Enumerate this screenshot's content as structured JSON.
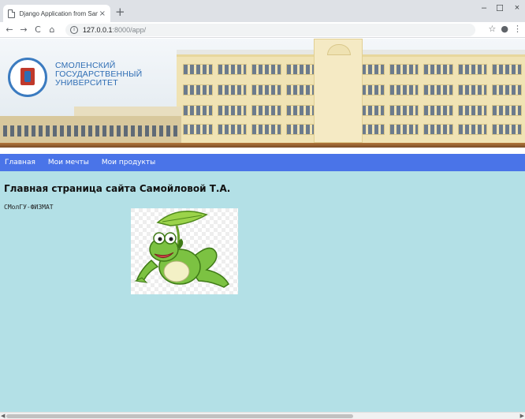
{
  "browser": {
    "tab_title": "Django Application from Samoilo",
    "tab_close": "×",
    "new_tab": "+",
    "minimize": "–",
    "maximize": "☐",
    "close": "×",
    "nav_back": "←",
    "nav_forward": "→",
    "nav_reload": "C",
    "nav_home": "⌂",
    "info": "i",
    "url_host": "127.0.0.1",
    "url_rest": ":8000/app/",
    "star": "☆",
    "account": "●",
    "menu": "⋮"
  },
  "banner": {
    "university_line1": "СМОЛЕНСКИЙ",
    "university_line2": "ГОСУДАРСТВЕННЫЙ",
    "university_line3": "УНИВЕРСИТЕТ"
  },
  "nav": {
    "items": [
      {
        "label": "Главная"
      },
      {
        "label": "Мои мечты"
      },
      {
        "label": "Мои продукты"
      }
    ]
  },
  "main": {
    "title": "Главная страница сайта Самойловой Т.А.",
    "subtitle": "СМолГУ-ФИЗМАТ"
  },
  "colors": {
    "page_background": "#b3e0e6",
    "nav_background": "#4a74e8",
    "logo_blue": "#2e6db4",
    "frog_green": "#7cc242"
  }
}
